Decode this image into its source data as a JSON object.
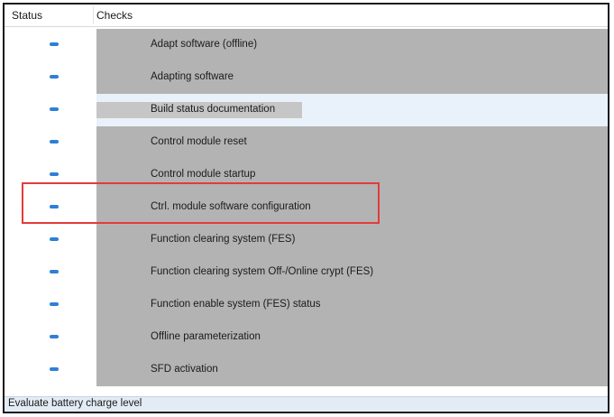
{
  "header": {
    "status_label": "Status",
    "checks_label": "Checks"
  },
  "rows": [
    {
      "status_icon": "dash-icon",
      "label": "Adapt software (offline)"
    },
    {
      "status_icon": "dash-icon",
      "label": "Adapting software"
    },
    {
      "status_icon": "dash-icon",
      "label": "Build status documentation"
    },
    {
      "status_icon": "dash-icon",
      "label": "Control module reset"
    },
    {
      "status_icon": "dash-icon",
      "label": "Control module startup"
    },
    {
      "status_icon": "dash-icon",
      "label": "Ctrl. module software configuration"
    },
    {
      "status_icon": "dash-icon",
      "label": "Function clearing system (FES)"
    },
    {
      "status_icon": "dash-icon",
      "label": "Function clearing system Off-/Online crypt (FES)"
    },
    {
      "status_icon": "dash-icon",
      "label": "Function enable system (FES) status"
    },
    {
      "status_icon": "dash-icon",
      "label": "Offline parameterization"
    },
    {
      "status_icon": "dash-icon",
      "label": "SFD activation"
    }
  ],
  "footer": {
    "status_text": "Evaluate battery charge level"
  },
  "colors": {
    "status_dash": "#2f7fd6",
    "row_fill": "#b3b3b3",
    "selected_row": "#e9f2fb",
    "highlight_box": "#e23b3b"
  }
}
